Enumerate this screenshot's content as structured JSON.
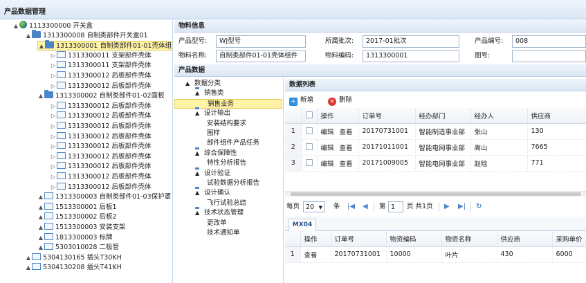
{
  "window_title": "产品数据管理",
  "tree": [
    {
      "label": "1113300000 开关盒",
      "icon": "globe-icon",
      "arrow": "▲",
      "indent": 0
    },
    {
      "label": "1313300008 自制类部件开关盒01",
      "icon": "folder-icon",
      "arrow": "▲",
      "indent": 1
    },
    {
      "label": "1313300001 自制类部件01-01壳体组件",
      "icon": "folder-icon",
      "arrow": "▲",
      "indent": 2,
      "selected": true
    },
    {
      "label": "1313300011 支架部件壳体",
      "icon": "doc-icon",
      "arrow": "▷",
      "indent": 3
    },
    {
      "label": "1313300011 支架部件壳体",
      "icon": "doc-icon",
      "arrow": "▷",
      "indent": 3
    },
    {
      "label": "1313300012 后板部件壳体",
      "icon": "doc-icon",
      "arrow": "▷",
      "indent": 3
    },
    {
      "label": "1313300012 后板部件壳体",
      "icon": "doc-icon",
      "arrow": "▷",
      "indent": 3
    },
    {
      "label": "1313300002 自制类部件01-02面板",
      "icon": "folder-icon",
      "arrow": "▲",
      "indent": 2
    },
    {
      "label": "1313300012 后板部件壳体",
      "icon": "doc-icon",
      "arrow": "▷",
      "indent": 3
    },
    {
      "label": "1313300012 后板部件壳体",
      "icon": "doc-icon",
      "arrow": "▷",
      "indent": 3
    },
    {
      "label": "1313300012 后板部件壳体",
      "icon": "doc-icon",
      "arrow": "▷",
      "indent": 3
    },
    {
      "label": "1313300012 后板部件壳体",
      "icon": "doc-icon",
      "arrow": "▷",
      "indent": 3
    },
    {
      "label": "1313300012 后板部件壳体",
      "icon": "doc-icon",
      "arrow": "▷",
      "indent": 3
    },
    {
      "label": "1313300012 后板部件壳体",
      "icon": "doc-icon",
      "arrow": "▷",
      "indent": 3
    },
    {
      "label": "1313300012 后板部件壳体",
      "icon": "doc-icon",
      "arrow": "▷",
      "indent": 3
    },
    {
      "label": "1313300012 后板部件壳体",
      "icon": "doc-icon",
      "arrow": "▷",
      "indent": 3
    },
    {
      "label": "1313300012 后板部件壳体",
      "icon": "doc-icon",
      "arrow": "▷",
      "indent": 3
    },
    {
      "label": "1313300003 自制类部件01-03保护罩",
      "icon": "doc-icon",
      "arrow": "▲",
      "indent": 2
    },
    {
      "label": "1513300001 后板1",
      "icon": "doc-icon",
      "arrow": "▲",
      "indent": 2
    },
    {
      "label": "1513300002 后板2",
      "icon": "doc-icon",
      "arrow": "▲",
      "indent": 2
    },
    {
      "label": "1513300003 安装支架",
      "icon": "doc-icon",
      "arrow": "▲",
      "indent": 2
    },
    {
      "label": "1813300003 标牌",
      "icon": "doc-icon",
      "arrow": "▲",
      "indent": 2
    },
    {
      "label": "5303010028 二极管",
      "icon": "doc-icon",
      "arrow": "▲",
      "indent": 2
    },
    {
      "label": "5304130165 插头T30KH",
      "icon": "doc-icon",
      "arrow": "▲",
      "indent": 1
    },
    {
      "label": "5304130208 插头T41KH",
      "icon": "doc-icon",
      "arrow": "▲",
      "indent": 1
    }
  ],
  "material_info": {
    "header": "物料信息",
    "product_model_label": "产品型号:",
    "product_model_value": "WJ型号",
    "batch_label": "所属批次:",
    "batch_value": "2017-01批次",
    "product_no_label": "产品编号:",
    "product_no_value": "008",
    "material_name_label": "物料名称:",
    "material_name_value": "自制类部件01-01壳体组件",
    "material_code_label": "物料编码:",
    "material_code_value": "1313300001",
    "drawing_no_label": "图号:",
    "drawing_no_value": ""
  },
  "product_data_header": "产品数据",
  "categories": [
    {
      "label": "数据分类",
      "icon": "globe-icon",
      "arrow": "▲",
      "indent": 0
    },
    {
      "label": "销售类",
      "icon": "folder-icon",
      "arrow": "▲",
      "indent": 1
    },
    {
      "label": "销售业务",
      "icon": "list-icon",
      "arrow": "",
      "indent": 2,
      "selected": true
    },
    {
      "label": "设计输出",
      "icon": "folder-icon",
      "arrow": "▲",
      "indent": 1
    },
    {
      "label": "安装结构要求",
      "icon": "list-icon",
      "arrow": "",
      "indent": 2
    },
    {
      "label": "图样",
      "icon": "list-icon",
      "arrow": "",
      "indent": 2
    },
    {
      "label": "部件组件产品任务",
      "icon": "list-icon",
      "arrow": "",
      "indent": 2
    },
    {
      "label": "综合保障性",
      "icon": "folder-icon",
      "arrow": "▲",
      "indent": 1
    },
    {
      "label": "特性分析报告",
      "icon": "list-icon",
      "arrow": "",
      "indent": 2
    },
    {
      "label": "设计验证",
      "icon": "folder-icon",
      "arrow": "▲",
      "indent": 1
    },
    {
      "label": "试验数据分析报告",
      "icon": "list-icon",
      "arrow": "",
      "indent": 2
    },
    {
      "label": "设计确认",
      "icon": "folder-icon",
      "arrow": "▲",
      "indent": 1
    },
    {
      "label": "飞行试验总结",
      "icon": "list-icon",
      "arrow": "",
      "indent": 2
    },
    {
      "label": "技术状态管理",
      "icon": "folder-icon",
      "arrow": "▲",
      "indent": 1
    },
    {
      "label": "更改单",
      "icon": "list-icon",
      "arrow": "",
      "indent": 2
    },
    {
      "label": "技术通知单",
      "icon": "list-icon",
      "arrow": "",
      "indent": 2
    }
  ],
  "data_list": {
    "header": "数据列表",
    "add_label": "新增",
    "delete_label": "删除",
    "columns": [
      "",
      "",
      "操作",
      "订单号",
      "经办部门",
      "经办人",
      "供应商"
    ],
    "rows": [
      {
        "n": "1",
        "edit": "编辑",
        "view": "查看",
        "order": "20170731001",
        "dept": "智能制造事业部",
        "person": "张山",
        "supplier": "130"
      },
      {
        "n": "2",
        "edit": "编辑",
        "view": "查看",
        "order": "20171011001",
        "dept": "智能电网事业部",
        "person": "高山",
        "supplier": "7665"
      },
      {
        "n": "3",
        "edit": "编辑",
        "view": "查看",
        "order": "20171009005",
        "dept": "智能电网事业部",
        "person": "赵晗",
        "supplier": "771"
      }
    ]
  },
  "pager": {
    "per_page_label": "每页",
    "per_page_value": "20",
    "unit_label": "条",
    "page_prefix": "第",
    "page_value": "1",
    "page_suffix": "页 共1页"
  },
  "subtab_label": "MX04",
  "detail": {
    "columns": [
      "",
      "操作",
      "订单号",
      "物资编码",
      "物资名称",
      "供应商",
      "采购单价"
    ],
    "rows": [
      {
        "n": "1",
        "view": "查看",
        "order": "20170731001",
        "code": "10000",
        "name": "叶片",
        "supplier": "430",
        "price": "6000"
      }
    ]
  },
  "colors": {
    "accent": "#4b86c9",
    "selected_bg": "#fff3a8",
    "header_bg": "#dbe7f5"
  }
}
